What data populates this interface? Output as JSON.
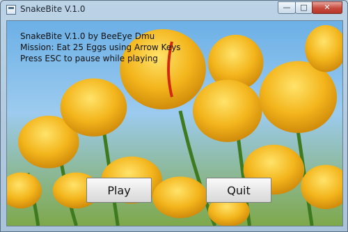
{
  "window": {
    "title": "SnakeBite V.1.0",
    "min_glyph": "—",
    "max_glyph": "□",
    "close_glyph": "✕"
  },
  "intro": {
    "line1": "SnakeBite V.1.0 by BeeEye Dmu",
    "line2": "Mission: Eat 25 Eggs using Arrow Keys",
    "line3": "Press ESC to pause while playing"
  },
  "buttons": {
    "play": "Play",
    "quit": "Quit"
  },
  "colors": {
    "tulip": "#f4b51f",
    "stem": "#3e7a1f",
    "sky": "#78b6e6"
  }
}
